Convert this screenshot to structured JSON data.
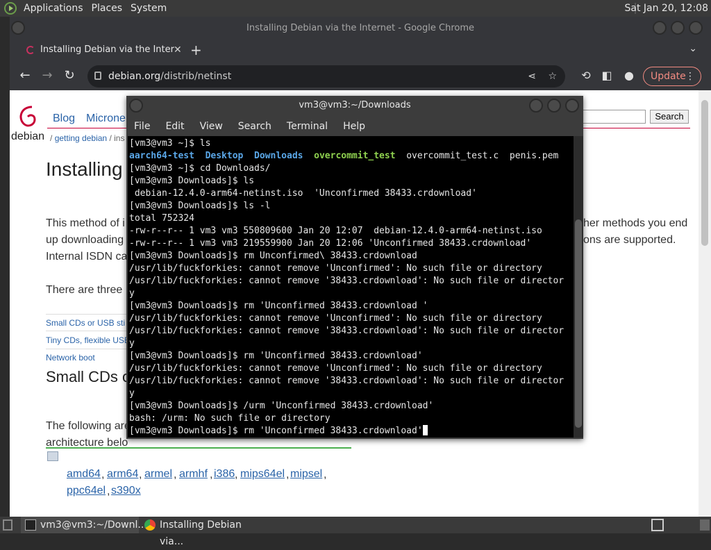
{
  "top_panel": {
    "menus": [
      "Applications",
      "Places",
      "System"
    ],
    "clock": "Sat Jan 20, 12:08"
  },
  "chrome": {
    "window_title": "Installing Debian via the Internet - Google Chrome",
    "tab_title": "Installing Debian via the Inter",
    "url_host": "debian.org",
    "url_path": "/distrib/netinst",
    "update_label": "Update"
  },
  "page": {
    "logo_text": "debian",
    "nav": [
      "Blog",
      "Microne"
    ],
    "breadcrumb_sep": "/",
    "breadcrumb_link": "getting debian",
    "breadcrumb_rest": "/ ins",
    "heading": "Installing",
    "para1_line1": "This method of i",
    "para1_line2": "up downloading",
    "para1_line3": "Internal ISDN ca",
    "para1_right1": "her methods you end",
    "para1_right2": "ons are supported.",
    "para2": "There are three",
    "toc": [
      "Small CDs or USB sti",
      "Tiny CDs, flexible USB",
      "Network boot"
    ],
    "h2": "Small CDs o",
    "para3_line1": "The following are",
    "para3_line2": "architecture belo",
    "arch_line1": [
      "amd64",
      "arm64",
      "armel",
      "armhf",
      "i386",
      "mips64el",
      "mipsel"
    ],
    "arch_line2": [
      "ppc64el",
      "s390x"
    ],
    "search_button": "Search"
  },
  "terminal": {
    "title": "vm3@vm3:~/Downloads",
    "menu": [
      "File",
      "Edit",
      "View",
      "Search",
      "Terminal",
      "Help"
    ],
    "prompt_home": "[vm3@vm3 ~]$ ",
    "prompt_dl": "[vm3@vm3 Downloads]$ ",
    "cmd_ls": "ls",
    "ls_dirs": [
      "aarch64-test",
      "Desktop",
      "Downloads"
    ],
    "ls_exec": "overcommit_test",
    "ls_files": "overcommit_test.c  penis.pem",
    "cmd_cd": "cd Downloads/",
    "ls2_out": " debian-12.4.0-arm64-netinst.iso  'Unconfirmed 38433.crdownload'",
    "cmd_lsl": "ls -l",
    "total": "total 752324",
    "row1": "-rw-r--r-- 1 vm3 vm3 550809600 Jan 20 12:07  debian-12.4.0-arm64-netinst.iso",
    "row2": "-rw-r--r-- 1 vm3 vm3 219559900 Jan 20 12:06 'Unconfirmed 38433.crdownload'",
    "cmd_rm1": "rm Unconfirmed\\ 38433.crdownload",
    "err_a": "/usr/lib/fuckforkies: cannot remove 'Unconfirmed': No such file or directory",
    "err_b": "/usr/lib/fuckforkies: cannot remove '38433.crdownload': No such file or director",
    "err_b_wrap": "y",
    "cmd_rm2": "rm 'Unconfirmed 38433.crdownload '",
    "cmd_rm3": "rm 'Unconfirmed 38433.crdownload'",
    "cmd_urm": "/urm 'Unconfirmed 38433.crdownload'",
    "bash_err": "bash: /urm: No such file or directory",
    "cmd_current": "rm 'Unconfirmed 38433.crdownload'"
  },
  "taskbar": {
    "terminal_task": "vm3@vm3:~/Downl...",
    "chrome_task": "Installing Debian via..."
  }
}
